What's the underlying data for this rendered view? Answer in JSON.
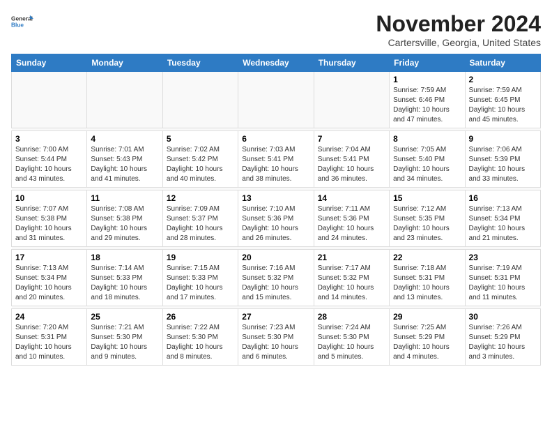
{
  "header": {
    "logo": {
      "general": "General",
      "blue": "Blue"
    },
    "title": "November 2024",
    "location": "Cartersville, Georgia, United States"
  },
  "days_of_week": [
    "Sunday",
    "Monday",
    "Tuesday",
    "Wednesday",
    "Thursday",
    "Friday",
    "Saturday"
  ],
  "weeks": [
    {
      "days": [
        {
          "num": "",
          "info": ""
        },
        {
          "num": "",
          "info": ""
        },
        {
          "num": "",
          "info": ""
        },
        {
          "num": "",
          "info": ""
        },
        {
          "num": "",
          "info": ""
        },
        {
          "num": "1",
          "info": "Sunrise: 7:59 AM\nSunset: 6:46 PM\nDaylight: 10 hours\nand 47 minutes."
        },
        {
          "num": "2",
          "info": "Sunrise: 7:59 AM\nSunset: 6:45 PM\nDaylight: 10 hours\nand 45 minutes."
        }
      ]
    },
    {
      "days": [
        {
          "num": "3",
          "info": "Sunrise: 7:00 AM\nSunset: 5:44 PM\nDaylight: 10 hours\nand 43 minutes."
        },
        {
          "num": "4",
          "info": "Sunrise: 7:01 AM\nSunset: 5:43 PM\nDaylight: 10 hours\nand 41 minutes."
        },
        {
          "num": "5",
          "info": "Sunrise: 7:02 AM\nSunset: 5:42 PM\nDaylight: 10 hours\nand 40 minutes."
        },
        {
          "num": "6",
          "info": "Sunrise: 7:03 AM\nSunset: 5:41 PM\nDaylight: 10 hours\nand 38 minutes."
        },
        {
          "num": "7",
          "info": "Sunrise: 7:04 AM\nSunset: 5:41 PM\nDaylight: 10 hours\nand 36 minutes."
        },
        {
          "num": "8",
          "info": "Sunrise: 7:05 AM\nSunset: 5:40 PM\nDaylight: 10 hours\nand 34 minutes."
        },
        {
          "num": "9",
          "info": "Sunrise: 7:06 AM\nSunset: 5:39 PM\nDaylight: 10 hours\nand 33 minutes."
        }
      ]
    },
    {
      "days": [
        {
          "num": "10",
          "info": "Sunrise: 7:07 AM\nSunset: 5:38 PM\nDaylight: 10 hours\nand 31 minutes."
        },
        {
          "num": "11",
          "info": "Sunrise: 7:08 AM\nSunset: 5:38 PM\nDaylight: 10 hours\nand 29 minutes."
        },
        {
          "num": "12",
          "info": "Sunrise: 7:09 AM\nSunset: 5:37 PM\nDaylight: 10 hours\nand 28 minutes."
        },
        {
          "num": "13",
          "info": "Sunrise: 7:10 AM\nSunset: 5:36 PM\nDaylight: 10 hours\nand 26 minutes."
        },
        {
          "num": "14",
          "info": "Sunrise: 7:11 AM\nSunset: 5:36 PM\nDaylight: 10 hours\nand 24 minutes."
        },
        {
          "num": "15",
          "info": "Sunrise: 7:12 AM\nSunset: 5:35 PM\nDaylight: 10 hours\nand 23 minutes."
        },
        {
          "num": "16",
          "info": "Sunrise: 7:13 AM\nSunset: 5:34 PM\nDaylight: 10 hours\nand 21 minutes."
        }
      ]
    },
    {
      "days": [
        {
          "num": "17",
          "info": "Sunrise: 7:13 AM\nSunset: 5:34 PM\nDaylight: 10 hours\nand 20 minutes."
        },
        {
          "num": "18",
          "info": "Sunrise: 7:14 AM\nSunset: 5:33 PM\nDaylight: 10 hours\nand 18 minutes."
        },
        {
          "num": "19",
          "info": "Sunrise: 7:15 AM\nSunset: 5:33 PM\nDaylight: 10 hours\nand 17 minutes."
        },
        {
          "num": "20",
          "info": "Sunrise: 7:16 AM\nSunset: 5:32 PM\nDaylight: 10 hours\nand 15 minutes."
        },
        {
          "num": "21",
          "info": "Sunrise: 7:17 AM\nSunset: 5:32 PM\nDaylight: 10 hours\nand 14 minutes."
        },
        {
          "num": "22",
          "info": "Sunrise: 7:18 AM\nSunset: 5:31 PM\nDaylight: 10 hours\nand 13 minutes."
        },
        {
          "num": "23",
          "info": "Sunrise: 7:19 AM\nSunset: 5:31 PM\nDaylight: 10 hours\nand 11 minutes."
        }
      ]
    },
    {
      "days": [
        {
          "num": "24",
          "info": "Sunrise: 7:20 AM\nSunset: 5:31 PM\nDaylight: 10 hours\nand 10 minutes."
        },
        {
          "num": "25",
          "info": "Sunrise: 7:21 AM\nSunset: 5:30 PM\nDaylight: 10 hours\nand 9 minutes."
        },
        {
          "num": "26",
          "info": "Sunrise: 7:22 AM\nSunset: 5:30 PM\nDaylight: 10 hours\nand 8 minutes."
        },
        {
          "num": "27",
          "info": "Sunrise: 7:23 AM\nSunset: 5:30 PM\nDaylight: 10 hours\nand 6 minutes."
        },
        {
          "num": "28",
          "info": "Sunrise: 7:24 AM\nSunset: 5:30 PM\nDaylight: 10 hours\nand 5 minutes."
        },
        {
          "num": "29",
          "info": "Sunrise: 7:25 AM\nSunset: 5:29 PM\nDaylight: 10 hours\nand 4 minutes."
        },
        {
          "num": "30",
          "info": "Sunrise: 7:26 AM\nSunset: 5:29 PM\nDaylight: 10 hours\nand 3 minutes."
        }
      ]
    }
  ]
}
